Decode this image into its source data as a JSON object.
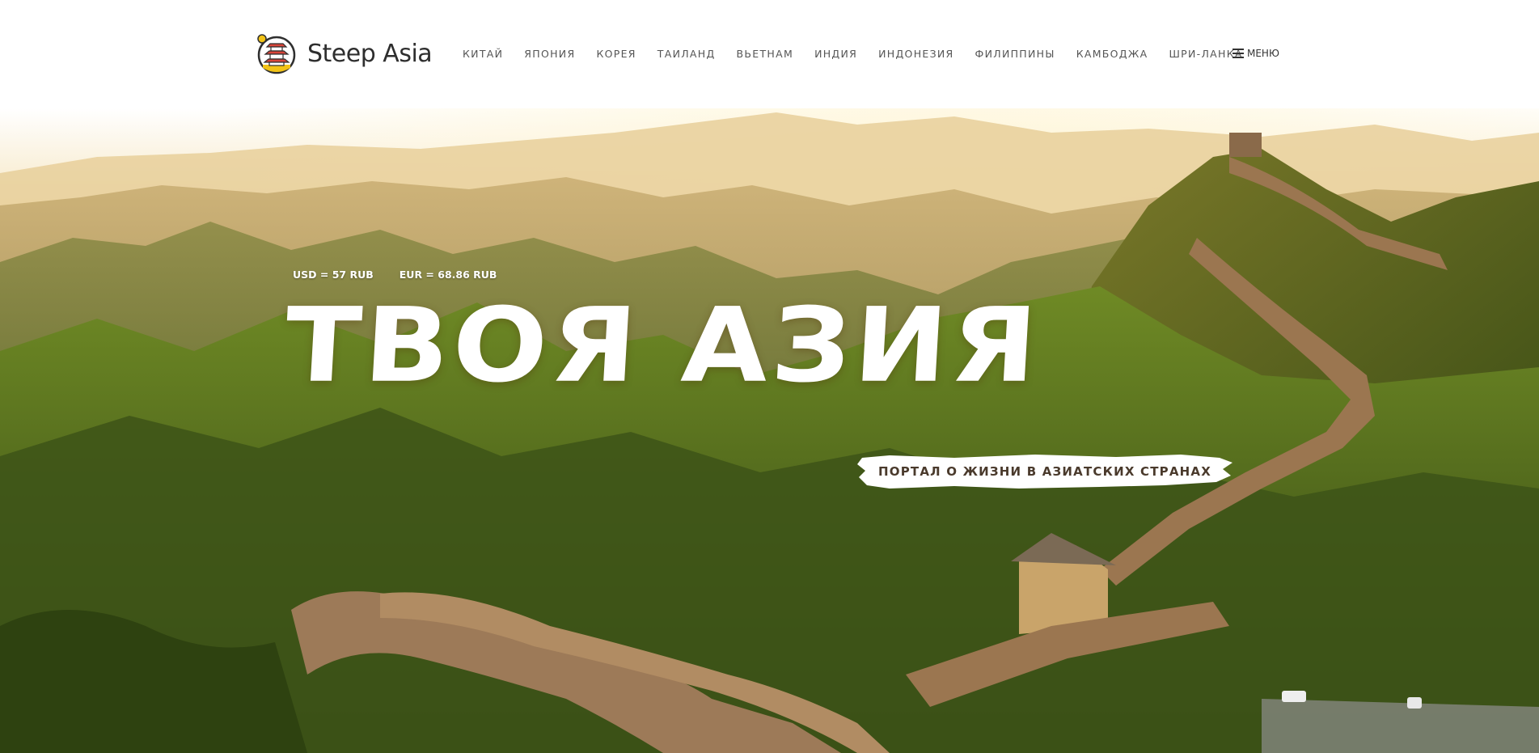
{
  "brand": {
    "name": "Steep Asia"
  },
  "nav": {
    "items": [
      "КИТАЙ",
      "ЯПОНИЯ",
      "КОРЕЯ",
      "ТАИЛАНД",
      "ВЬЕТНАМ",
      "ИНДИЯ",
      "ИНДОНЕЗИЯ",
      "ФИЛИППИНЫ",
      "КАМБОДЖА",
      "ШРИ-ЛАНКА"
    ],
    "menu_label": "МЕНЮ",
    "menu_icon": "hamburger-icon"
  },
  "hero": {
    "rates": [
      "USD = 57 RUB",
      "EUR = 68.86 RUB"
    ],
    "title": "ТВОЯ АЗИЯ",
    "tagline": "ПОРТАЛ О ЖИЗНИ В АЗИАТСКИХ СТРАНАХ"
  },
  "colors": {
    "logo_ring": "#2f2f2f",
    "logo_sun": "#f2c316",
    "logo_pagoda": "#d8453a",
    "sky": "#f6e2b0",
    "hill": "#4f6a20",
    "wall": "#8a6a4a"
  }
}
